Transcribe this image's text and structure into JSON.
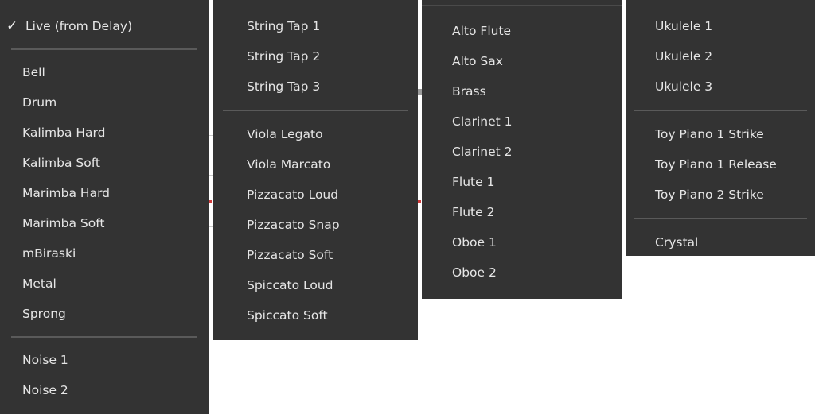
{
  "menus": [
    {
      "name": "menu-live-percussive",
      "items": [
        {
          "label": "Live (from Delay)",
          "checked": true
        },
        {
          "separator": true
        },
        {
          "label": "Bell"
        },
        {
          "label": "Drum"
        },
        {
          "label": "Kalimba Hard"
        },
        {
          "label": "Kalimba Soft"
        },
        {
          "label": "Marimba Hard"
        },
        {
          "label": "Marimba Soft"
        },
        {
          "label": "mBiraski"
        },
        {
          "label": "Metal"
        },
        {
          "label": "Sprong"
        },
        {
          "separator": true
        },
        {
          "label": "Noise 1"
        },
        {
          "label": "Noise 2"
        }
      ]
    },
    {
      "name": "menu-strings",
      "items": [
        {
          "label": "String Tap 1"
        },
        {
          "label": "String Tap 2"
        },
        {
          "label": "String Tap 3"
        },
        {
          "separator": true
        },
        {
          "label": "Viola Legato"
        },
        {
          "label": "Viola Marcato"
        },
        {
          "label": "Pizzacato Loud"
        },
        {
          "label": "Pizzacato Snap"
        },
        {
          "label": "Pizzacato Soft"
        },
        {
          "label": "Spiccato Loud"
        },
        {
          "label": "Spiccato Soft"
        }
      ]
    },
    {
      "name": "menu-winds",
      "items": [
        {
          "label": "Alto Flute"
        },
        {
          "label": "Alto Sax"
        },
        {
          "label": "Brass"
        },
        {
          "label": "Clarinet 1"
        },
        {
          "label": "Clarinet 2"
        },
        {
          "label": "Flute 1"
        },
        {
          "label": "Flute 2"
        },
        {
          "label": "Oboe 1"
        },
        {
          "label": "Oboe 2"
        }
      ]
    },
    {
      "name": "menu-ukulele-toy",
      "items": [
        {
          "label": "Ukulele 1"
        },
        {
          "label": "Ukulele 2"
        },
        {
          "label": "Ukulele 3"
        },
        {
          "separator": true
        },
        {
          "label": "Toy Piano 1 Strike"
        },
        {
          "label": "Toy Piano 1 Release"
        },
        {
          "label": "Toy Piano 2 Strike"
        },
        {
          "separator": true
        },
        {
          "label": "Crystal"
        }
      ]
    }
  ],
  "check_glyph": "✓",
  "colors": {
    "menu_bg": "#333333",
    "menu_text": "#e6e6e6",
    "separator": "#5a5a5a"
  }
}
